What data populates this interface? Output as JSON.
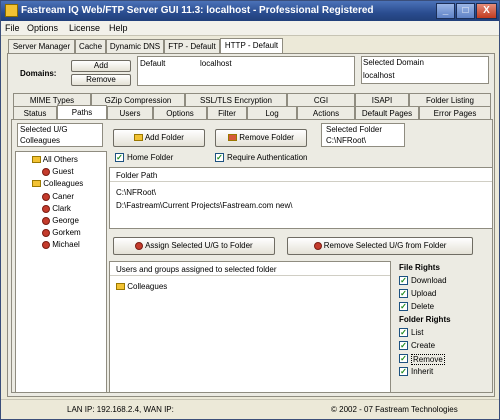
{
  "window": {
    "title": "Fastream IQ Web/FTP Server GUI 11.3: localhost - Professional Registered",
    "minimize": "_",
    "maximize": "□",
    "close": "X"
  },
  "menu": {
    "file": "File",
    "options": "Options",
    "license": "License",
    "help": "Help"
  },
  "server_tabs": [
    "Server Manager",
    "Cache",
    "Dynamic DNS",
    "FTP - Default",
    "HTTP - Default"
  ],
  "domains": {
    "label": "Domains:",
    "add": "Add",
    "remove": "Remove",
    "list_name": "Default",
    "list_host": "localhost",
    "selected_label": "Selected Domain",
    "selected_value": "localhost"
  },
  "tabs_row1": [
    "MIME Types",
    "GZip Compression",
    "SSL/TLS Encryption",
    "CGI",
    "ISAPI",
    "Folder Listing"
  ],
  "tabs_row2": [
    "Status",
    "Paths",
    "Users",
    "Options",
    "Filter",
    "Log",
    "Actions",
    "Default Pages",
    "Error Pages"
  ],
  "selected_ug": {
    "label": "Selected U/G",
    "value": "Colleagues"
  },
  "tree": {
    "all_others": "All Others",
    "guest": "Guest",
    "colleagues": "Colleagues",
    "members": [
      "Caner",
      "Clark",
      "George",
      "Gorkem",
      "Michael"
    ]
  },
  "folder_actions": {
    "add": "Add Folder",
    "remove": "Remove Folder",
    "selected_label": "Selected Folder",
    "selected_value": "C:\\NFRoot\\"
  },
  "options": {
    "home_folder": "Home Folder",
    "require_auth": "Require Authentication"
  },
  "folder_path": {
    "header": "Folder Path",
    "items": [
      "C:\\NFRoot\\",
      "D:\\Fastream\\Current Projects\\Fastream.com new\\"
    ]
  },
  "assign": {
    "assign": "Assign Selected U/G to Folder",
    "remove": "Remove Selected U/G from Folder"
  },
  "assigned": {
    "header": "Users and groups assigned to selected folder",
    "items": [
      "Colleagues"
    ]
  },
  "file_rights": {
    "title": "File Rights",
    "items": [
      "Download",
      "Upload",
      "Delete"
    ]
  },
  "folder_rights": {
    "title": "Folder Rights",
    "items": [
      "List",
      "Create",
      "Remove",
      "Inherit"
    ]
  },
  "status": {
    "ip": "LAN IP: 192.168.2.4, WAN IP:",
    "copyright": "© 2002 - 07 Fastream Technologies"
  },
  "colors": {
    "title_bar": "#2a4c8f",
    "folder": "#f2c233",
    "user": "#c43b2c",
    "check": "#1d8a1d"
  }
}
